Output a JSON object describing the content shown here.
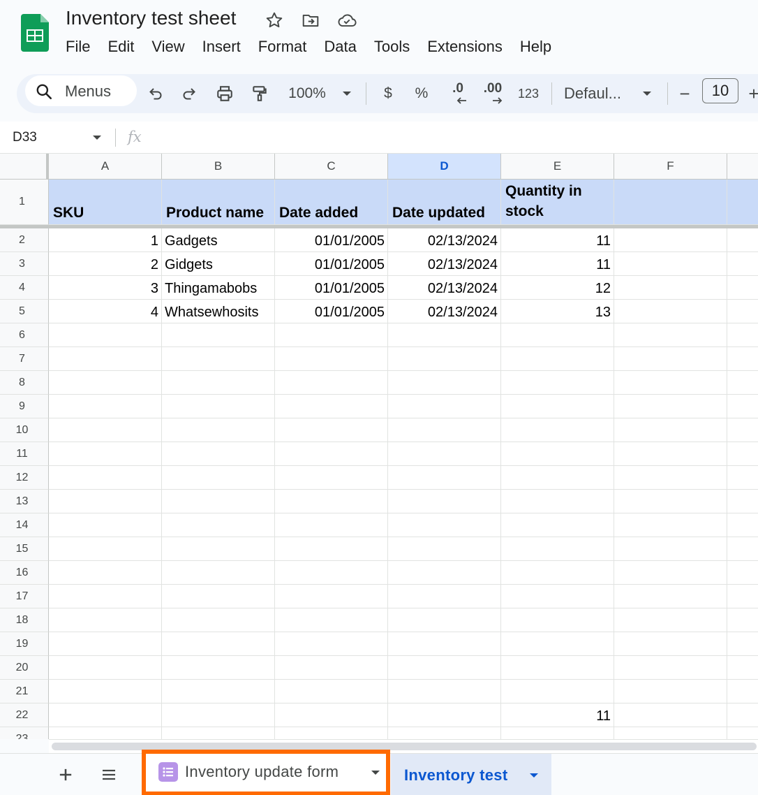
{
  "app": {
    "doc_title": "Inventory test sheet",
    "menus": [
      "File",
      "Edit",
      "View",
      "Insert",
      "Format",
      "Data",
      "Tools",
      "Extensions",
      "Help"
    ]
  },
  "toolbar": {
    "search_label": "Menus",
    "zoom": "100%",
    "currency": "$",
    "percent": "%",
    "decrease_decimal": ".0",
    "increase_decimal": ".00",
    "number_format": "123",
    "font": "Defaul...",
    "font_size": "10",
    "minus": "−",
    "plus": "+"
  },
  "formula_bar": {
    "name_box": "D33",
    "fx": "fx"
  },
  "grid": {
    "columns": [
      "A",
      "B",
      "C",
      "D",
      "E",
      "F"
    ],
    "selected_column": "D",
    "header_row": [
      "SKU",
      "Product name",
      "Date added",
      "Date updated",
      "Quantity in stock",
      ""
    ],
    "rows": [
      [
        "1",
        "Gadgets",
        "01/01/2005",
        "02/13/2024",
        "11"
      ],
      [
        "2",
        "Gidgets",
        "01/01/2005",
        "02/13/2024",
        "11"
      ],
      [
        "3",
        "Thingamabobs",
        "01/01/2005",
        "02/13/2024",
        "12"
      ],
      [
        "4",
        "Whatsewhosits",
        "01/01/2005",
        "02/13/2024",
        "13"
      ]
    ],
    "row_numbers": [
      "1",
      "2",
      "3",
      "4",
      "5",
      "6",
      "7",
      "8",
      "9",
      "10",
      "11",
      "12",
      "13",
      "14",
      "15",
      "16",
      "17",
      "18",
      "19",
      "20",
      "21",
      "22",
      "23"
    ],
    "row22_e": "11",
    "header_e_line1": "Quantity in",
    "header_e_line2": "stock"
  },
  "sheets": {
    "tabs": [
      {
        "label": "Inventory update form",
        "active": false,
        "highlighted": true
      },
      {
        "label": "Inventory test",
        "active": true
      }
    ]
  },
  "colors": {
    "header_fill": "#c9daf8",
    "accent": "#0b57d0",
    "highlight_border": "#ff6a00",
    "logo_green": "#0f9d58"
  }
}
